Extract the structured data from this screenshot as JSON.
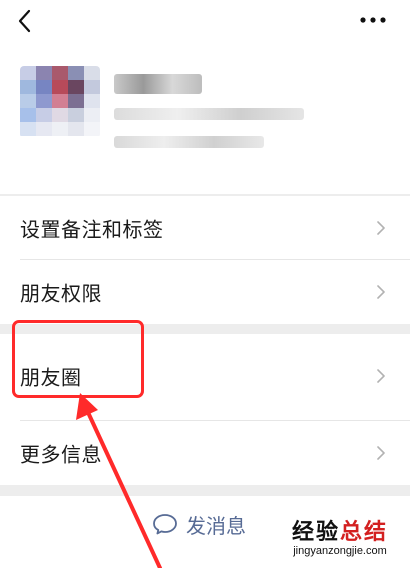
{
  "header": {
    "back_icon": "chevron-left-icon",
    "more_icon": "more-dots-icon"
  },
  "menu": [
    {
      "label": "设置备注和标签"
    },
    {
      "label": "朋友权限"
    },
    {
      "label": "朋友圈"
    },
    {
      "label": "更多信息"
    }
  ],
  "message": {
    "label": "发消息",
    "icon": "chat-bubble-icon"
  },
  "watermark": {
    "brand_left": "经验",
    "brand_right": "总结",
    "domain": "jingyanzongjie.com"
  },
  "colors": {
    "highlight": "#ff2a2a",
    "link": "#576b95",
    "gap": "#ededed"
  }
}
